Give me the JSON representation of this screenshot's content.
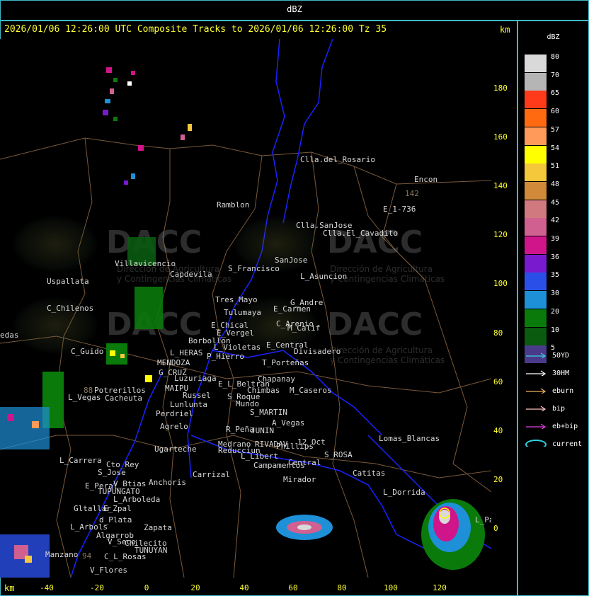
{
  "header": {
    "title": "dBZ",
    "line": "2026/01/06 12:26:00 UTC Composite Tracks to 2026/01/06 12:26:00 Tz 35",
    "km_top": "km",
    "km_bottom": "km"
  },
  "axes": {
    "y_ticks": [
      "180",
      "160",
      "140",
      "120",
      "100",
      "80",
      "60",
      "40",
      "20",
      "0"
    ],
    "x_ticks": [
      "-40",
      "-20",
      "0",
      "20",
      "40",
      "60",
      "80",
      "100",
      "120"
    ]
  },
  "watermark": {
    "brand": "DACC",
    "line1": "Dirección de Agricultura",
    "line2": "y Contingencias Climáticas"
  },
  "places": [
    "Clla.del_Rosario",
    "Encon",
    "142",
    "E_1-736",
    "Ramblon",
    "Clla.SanJose",
    "Clla.El_Cavadito",
    "Villavicencio",
    "Capdevila",
    "S_Francisco",
    "SanJose",
    "L_Asuncion",
    "Uspallata",
    "C_Chilenos",
    "Tres_Mayo",
    "Tulumaya",
    "G_Andre",
    "E_Carmen",
    "E_Chical",
    "E_Vergel",
    "C_Arenio",
    "M_Calif",
    "Borbollon",
    "L_Violetas",
    "E_Central",
    "Divisadero",
    "edas",
    "C_Guido",
    "L_HERAS",
    "P_Hierro",
    "T_Porteñas",
    "MENDOZA",
    "G_CRUZ",
    "Luzuriaga",
    "E_L_Beltran",
    "Chapanay",
    "Chimbas",
    "M_Caseros",
    "88",
    "Potrerillos",
    "Cacheuta",
    "MAIPU",
    "Russel",
    "Lunlunta",
    "L_Vegas",
    "S_Roque",
    "Mundo",
    "Perdriel",
    "S_MARTIN",
    "Agrelo",
    "A_Vegas",
    "Reducciun",
    "R_Peña",
    "JUNIN",
    "Lomas_Blancas",
    "Ugarteche",
    "Medrano",
    "RIVADAV",
    "Phillips",
    "L_Libert",
    "S_ROSA",
    "12_Oct",
    "L_Carrera",
    "Cto_Rey",
    "S_Jose",
    "Campamentos",
    "Central",
    "Catitas",
    "Carrizal",
    "Anchoris",
    "E_Peral",
    "TUPUNGATO",
    "V_Btias",
    "Mirador",
    "L_Dorrida",
    "L_Arboleda",
    "Gltallar",
    "E_Zpal",
    "d_Plata",
    "Zapata",
    "L_Arbols",
    "Algarrob",
    "V_Seco",
    "Chilecito",
    "TUNUYAN",
    "C_L_Rosas",
    "Manzano",
    "94",
    "V_Flores",
    "L_Paz"
  ],
  "legend": {
    "title": "dBZ",
    "levels": [
      {
        "label": "80",
        "color": "#d9d9d9"
      },
      {
        "label": "70",
        "color": "#b5b5b5"
      },
      {
        "label": "65",
        "color": "#ff3a1a"
      },
      {
        "label": "60",
        "color": "#ff6a10"
      },
      {
        "label": "57",
        "color": "#ff9a5a"
      },
      {
        "label": "54",
        "color": "#ffff00"
      },
      {
        "label": "51",
        "color": "#f5c73a"
      },
      {
        "label": "48",
        "color": "#d08a3a"
      },
      {
        "label": "45",
        "color": "#d07a80"
      },
      {
        "label": "42",
        "color": "#d06090"
      },
      {
        "label": "39",
        "color": "#d0148a"
      },
      {
        "label": "36",
        "color": "#7a1acf"
      },
      {
        "label": "35",
        "color": "#2a4fe8"
      },
      {
        "label": "30",
        "color": "#1e90d8"
      },
      {
        "label": "20",
        "color": "#0a7a0a"
      },
      {
        "label": "10",
        "color": "#0a5a10"
      },
      {
        "label": "5",
        "color": "#4a3a8a"
      }
    ],
    "tracks": [
      {
        "label": "50YD",
        "color": "#3ad0e0"
      },
      {
        "label": "30HM",
        "color": "#ffffff"
      },
      {
        "label": "eburn",
        "color": "#f0b060"
      },
      {
        "label": "bip",
        "color": "#ffc0c0"
      },
      {
        "label": "eb+bip",
        "color": "#e040e0"
      },
      {
        "label": "current",
        "color": "#30d0e0"
      }
    ]
  }
}
